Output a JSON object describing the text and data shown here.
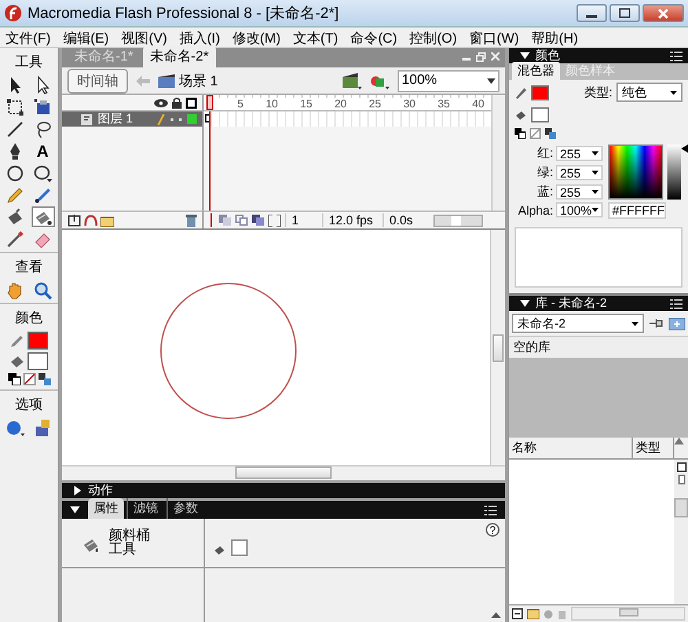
{
  "window": {
    "title": "Macromedia Flash Professional 8 - [未命名-2*]"
  },
  "menu": [
    "文件(F)",
    "编辑(E)",
    "视图(V)",
    "插入(I)",
    "修改(M)",
    "文本(T)",
    "命令(C)",
    "控制(O)",
    "窗口(W)",
    "帮助(H)"
  ],
  "toolbox": {
    "title": "工具",
    "tools": [
      {
        "selected": false
      },
      {
        "selected": false
      },
      {
        "selected": false
      },
      {
        "selected": false
      },
      {
        "selected": false
      },
      {
        "selected": false
      },
      {
        "selected": false
      },
      {
        "glyph": "A",
        "selected": false
      },
      {
        "selected": false
      },
      {
        "selected": false
      },
      {
        "selected": false
      },
      {
        "selected": false
      },
      {
        "selected": false
      },
      {
        "selected": true
      },
      {
        "selected": false
      },
      {
        "selected": false
      }
    ],
    "view_title": "查看",
    "color_title": "颜色",
    "stroke": {
      "color": "#ff0000"
    },
    "fill": {
      "color": "#ffffff"
    },
    "options_title": "选项"
  },
  "document": {
    "tabs": [
      {
        "label": "未命名-1*",
        "selected": false
      },
      {
        "label": "未命名-2*",
        "selected": true
      }
    ],
    "timeline_button": "时间轴",
    "scene": "场景 1",
    "zoom": "100%",
    "frame_numbers": [
      "5",
      "10",
      "15",
      "20",
      "25",
      "30",
      "35",
      "40"
    ],
    "layers": [
      {
        "name": "图层 1",
        "selected": true
      }
    ],
    "current_frame": "1",
    "frame_rate": "12.0 fps",
    "elapsed_time": "0.0s"
  },
  "actions_panel": {
    "title": "动作",
    "expanded": false
  },
  "properties_panel": {
    "expanded": true,
    "tabs": [
      {
        "label": "属性",
        "selected": true
      },
      {
        "label": "滤镜",
        "selected": false
      },
      {
        "label": "参数",
        "selected": false
      }
    ],
    "tool_name": "颜料桶工具",
    "fill": {
      "color": "#ffffff"
    },
    "help_button": "?"
  },
  "color_panel": {
    "title": "颜色",
    "expanded": true,
    "tabs": [
      {
        "label": "混色器",
        "selected": true
      },
      {
        "label": "颜色样本",
        "selected": false
      }
    ],
    "stroke": {
      "color": "#ff0000"
    },
    "fill": {
      "color": "#ffffff"
    },
    "type_label": "类型:",
    "type_value": "纯色",
    "channels": [
      {
        "label": "红:",
        "value": "255"
      },
      {
        "label": "绿:",
        "value": "255"
      },
      {
        "label": "蓝:",
        "value": "255"
      },
      {
        "label": "Alpha:",
        "value": "100%"
      }
    ],
    "hex": "#FFFFFF",
    "brightness": {
      "level": 1
    }
  },
  "library_panel": {
    "title": "库 - 未命名-2",
    "expanded": true,
    "document": "未命名-2",
    "status": "空的库",
    "columns": [
      "名称",
      "类型"
    ]
  }
}
